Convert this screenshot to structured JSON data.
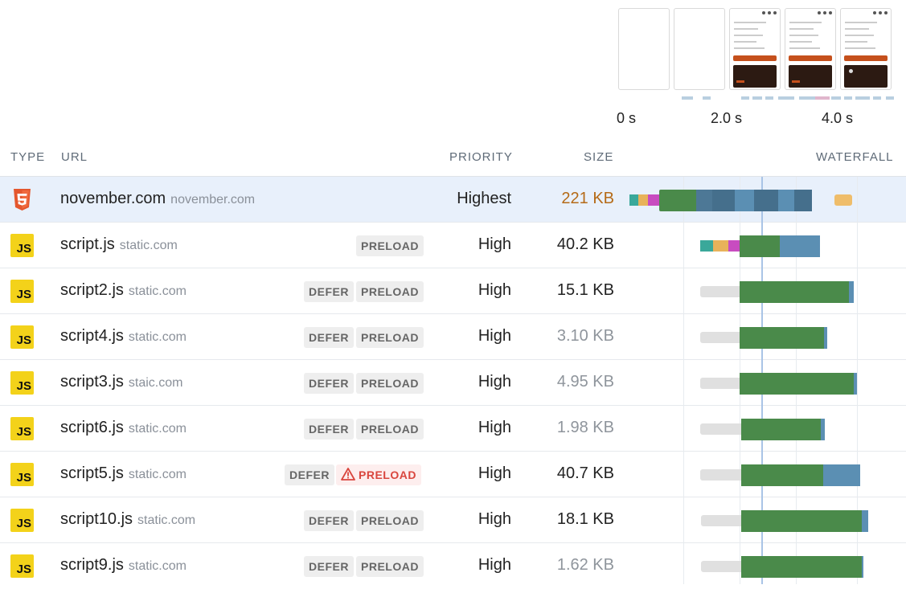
{
  "filmstrip": {
    "time_labels": [
      "0 s",
      "2.0 s",
      "4.0 s"
    ]
  },
  "table": {
    "headers": {
      "type": "TYPE",
      "url": "URL",
      "priority": "PRIORITY",
      "size": "SIZE",
      "waterfall": "WATERFALL"
    },
    "rows": [
      {
        "type": "html",
        "name": "november.com",
        "host": "november.com",
        "badges": [],
        "priority": "Highest",
        "size": "221 KB",
        "size_style": "large"
      },
      {
        "type": "js",
        "name": "script.js",
        "host": "static.com",
        "badges": [
          "PRELOAD"
        ],
        "priority": "High",
        "size": "40.2 KB",
        "size_style": "normal"
      },
      {
        "type": "js",
        "name": "script2.js",
        "host": "static.com",
        "badges": [
          "DEFER",
          "PRELOAD"
        ],
        "priority": "High",
        "size": "15.1 KB",
        "size_style": "normal"
      },
      {
        "type": "js",
        "name": "script4.js",
        "host": "static.com",
        "badges": [
          "DEFER",
          "PRELOAD"
        ],
        "priority": "High",
        "size": "3.10 KB",
        "size_style": "muted"
      },
      {
        "type": "js",
        "name": "script3.js",
        "host": "staic.com",
        "badges": [
          "DEFER",
          "PRELOAD"
        ],
        "priority": "High",
        "size": "4.95 KB",
        "size_style": "muted"
      },
      {
        "type": "js",
        "name": "script6.js",
        "host": "static.com",
        "badges": [
          "DEFER",
          "PRELOAD"
        ],
        "priority": "High",
        "size": "1.98 KB",
        "size_style": "muted"
      },
      {
        "type": "js",
        "name": "script5.js",
        "host": "static.com",
        "badges": [
          "DEFER",
          "PRELOAD"
        ],
        "warn_badge": "PRELOAD",
        "priority": "High",
        "size": "40.7 KB",
        "size_style": "normal"
      },
      {
        "type": "js",
        "name": "script10.js",
        "host": "static.com",
        "badges": [
          "DEFER",
          "PRELOAD"
        ],
        "priority": "High",
        "size": "18.1 KB",
        "size_style": "normal"
      },
      {
        "type": "js",
        "name": "script9.js",
        "host": "static.com",
        "badges": [
          "DEFER",
          "PRELOAD"
        ],
        "priority": "High",
        "size": "1.62 KB",
        "size_style": "muted"
      }
    ]
  },
  "icons": {
    "html": "html5-icon",
    "js": "javascript-icon",
    "warning": "warning-icon"
  },
  "colors": {
    "highlight_row": "#e8f0fb",
    "download": "#4a8a4a",
    "request": "#5b8fb3",
    "wait": "#e0e0e0",
    "dns": "#3aa89a",
    "connect": "#e8b25a",
    "ssl": "#c84cc0",
    "warning": "#d9463e",
    "size_large": "#b56a17"
  }
}
